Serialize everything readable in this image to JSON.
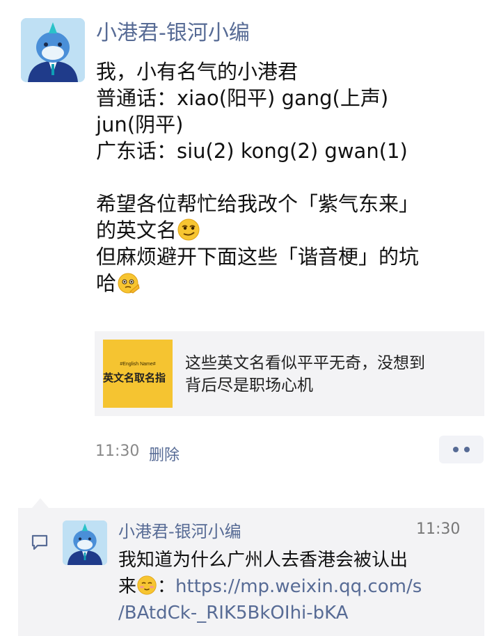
{
  "post": {
    "author": "小港君-银河小编",
    "lines": [
      "我，小有名气的小港君",
      "普通话：xiao(阳平) gang(上声)",
      "jun(阴平)",
      "广东话：siu(2) kong(2) gwan(1)"
    ],
    "paragraph2_line1": "希望各位帮忙给我改个「紫气东来」",
    "paragraph2_line2": "的英文名",
    "paragraph2_line3": "但麻烦避开下面这些「谐音梗」的坑",
    "paragraph2_line4": "哈",
    "emoji_1": "smirk-emoji",
    "emoji_2": "salute-emoji",
    "time": "11:30",
    "delete_label": "删除"
  },
  "link_card": {
    "thumb_small_text": "#English Name#",
    "thumb_main_text": "英文名取名指",
    "thumb_color": "#f5c431",
    "title_line1": "这些英文名看似平平无奇，没想到",
    "title_line2": "背后尽是职场心机"
  },
  "comment": {
    "author": "小港君-银河小编",
    "time": "11:30",
    "line1": "我知道为什么广州人去香港会被认出",
    "line2_prefix": "来",
    "line2_sep": "：",
    "link_part1": "https://mp.weixin.qq.com/s",
    "link_part2": "/BAtdCk-_RIK5BkOIhi-bKA",
    "emoji": "shy-smile-emoji"
  },
  "colors": {
    "name_blue": "#576b95",
    "card_bg": "#f3f3f5"
  }
}
